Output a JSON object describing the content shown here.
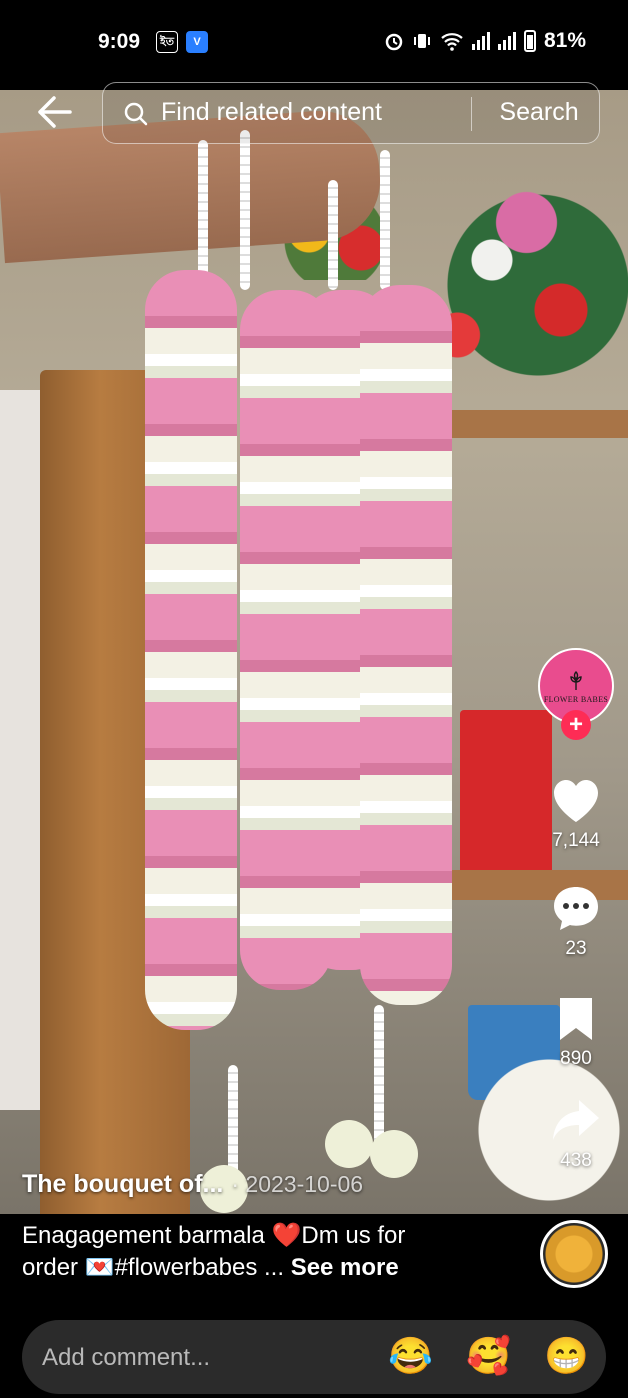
{
  "status_bar": {
    "time": "9:09",
    "left_icons": [
      "sim-icon",
      "app-icon"
    ],
    "sim_label": "ইত",
    "battery": "81%"
  },
  "search": {
    "placeholder": "Find related content",
    "button": "Search"
  },
  "creator": {
    "avatar_text": "FLOWER BABES",
    "follow": "+"
  },
  "actions": {
    "likes": "7,144",
    "comments": "23",
    "saves": "890",
    "shares": "438"
  },
  "post": {
    "author": "The  bouquet  of...",
    "date": "· 2023-10-06",
    "caption_line1": "Enagagement barmala ❤️Dm us for",
    "caption_line2": "order 💌#flowerbabes ...",
    "see_more": "See more"
  },
  "comment_bar": {
    "placeholder": "Add comment...",
    "emojis": [
      "😂",
      "🥰",
      "😁"
    ]
  },
  "colors": {
    "accent": "#fe2c55",
    "avatar_bg": "#e94c8e",
    "background": "#000000"
  }
}
